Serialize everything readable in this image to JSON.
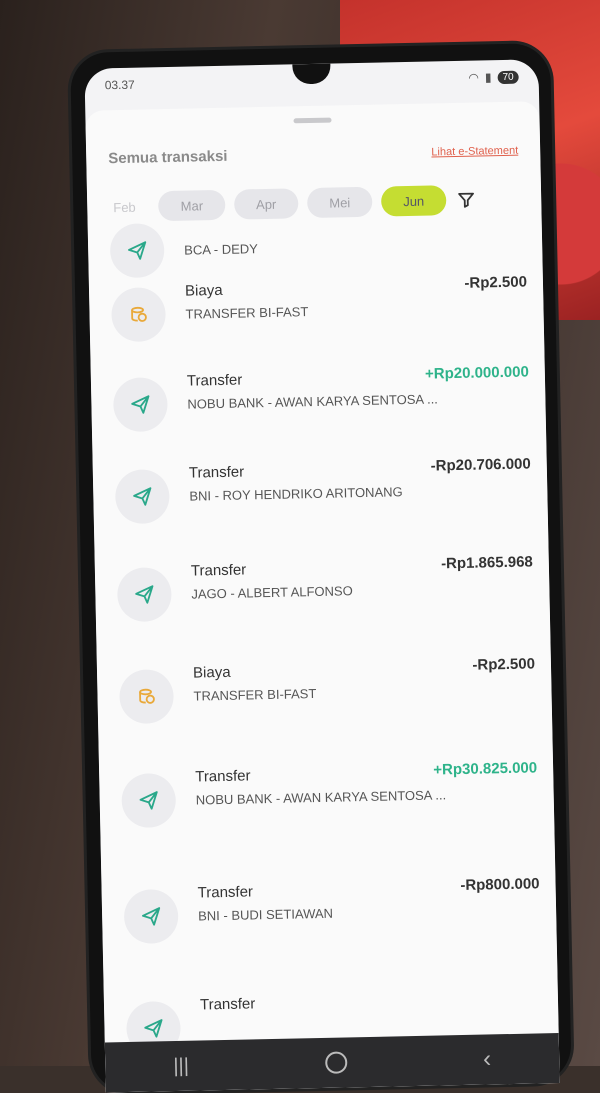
{
  "status_bar": {
    "time": "03.37",
    "battery": "70"
  },
  "header": {
    "title": "Semua transaksi",
    "estatement_link": "Lihat e-Statement"
  },
  "months": [
    {
      "label": "Feb",
      "active": false
    },
    {
      "label": "Mar",
      "active": false
    },
    {
      "label": "Apr",
      "active": false
    },
    {
      "label": "Mei",
      "active": false
    },
    {
      "label": "Jun",
      "active": true
    }
  ],
  "transactions": [
    {
      "type": "",
      "desc": "BCA - DEDY",
      "amount": "",
      "icon": "send-icon",
      "positive": false
    },
    {
      "type": "Biaya",
      "desc": "TRANSFER BI-FAST",
      "amount": "-Rp2.500",
      "icon": "coin-icon",
      "positive": false
    },
    {
      "type": "Transfer",
      "desc": "NOBU BANK - AWAN KARYA SENTOSA ...",
      "amount": "+Rp20.000.000",
      "icon": "send-icon",
      "positive": true
    },
    {
      "type": "Transfer",
      "desc": "BNI - ROY HENDRIKO ARITONANG",
      "amount": "-Rp20.706.000",
      "icon": "send-icon",
      "positive": false
    },
    {
      "type": "Transfer",
      "desc": "JAGO - ALBERT ALFONSO",
      "amount": "-Rp1.865.968",
      "icon": "send-icon",
      "positive": false
    },
    {
      "type": "Biaya",
      "desc": "TRANSFER BI-FAST",
      "amount": "-Rp2.500",
      "icon": "coin-icon",
      "positive": false
    },
    {
      "type": "Transfer",
      "desc": "NOBU BANK - AWAN KARYA SENTOSA ...",
      "amount": "+Rp30.825.000",
      "icon": "send-icon",
      "positive": true
    },
    {
      "type": "Transfer",
      "desc": "BNI - BUDI SETIAWAN",
      "amount": "-Rp800.000",
      "icon": "send-icon",
      "positive": false
    },
    {
      "type": "Transfer",
      "desc": "",
      "amount": "",
      "icon": "send-icon",
      "positive": false
    }
  ],
  "colors": {
    "accent": "#c5dd32",
    "positive": "#2eb38a",
    "link": "#e0604c",
    "send_icon": "#2aa88a",
    "coin_icon": "#e9a93a"
  }
}
